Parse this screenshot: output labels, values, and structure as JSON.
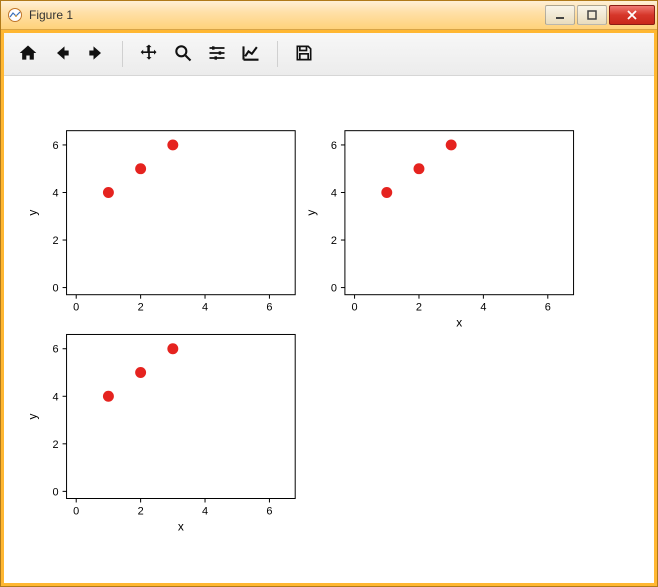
{
  "window": {
    "title": "Figure 1"
  },
  "toolbar": {
    "home": "home-icon",
    "back": "back-icon",
    "forward": "forward-icon",
    "pan": "pan-icon",
    "zoom": "zoom-icon",
    "configure": "configure-icon",
    "axes": "axes-icon",
    "save": "save-icon"
  },
  "chart_data": [
    {
      "type": "scatter",
      "x": [
        1,
        2,
        3
      ],
      "y": [
        4,
        5,
        6
      ],
      "xlabel": "",
      "ylabel": "y",
      "xticks": [
        0,
        2,
        4,
        6
      ],
      "yticks": [
        0,
        2,
        4,
        6
      ],
      "xlim": [
        -0.3,
        6.8
      ],
      "ylim": [
        -0.3,
        6.6
      ],
      "marker_color": "#e5231f"
    },
    {
      "type": "scatter",
      "x": [
        1,
        2,
        3
      ],
      "y": [
        4,
        5,
        6
      ],
      "xlabel": "x",
      "ylabel": "y",
      "xticks": [
        0,
        2,
        4,
        6
      ],
      "yticks": [
        0,
        2,
        4,
        6
      ],
      "xlim": [
        -0.3,
        6.8
      ],
      "ylim": [
        -0.3,
        6.6
      ],
      "marker_color": "#e5231f"
    },
    {
      "type": "scatter",
      "x": [
        1,
        2,
        3
      ],
      "y": [
        4,
        5,
        6
      ],
      "xlabel": "x",
      "ylabel": "y",
      "xticks": [
        0,
        2,
        4,
        6
      ],
      "yticks": [
        0,
        2,
        4,
        6
      ],
      "xlim": [
        -0.3,
        6.8
      ],
      "ylim": [
        -0.3,
        6.6
      ],
      "marker_color": "#e5231f"
    }
  ],
  "layout": {
    "subplots": [
      {
        "row": 0,
        "col": 0,
        "chart_index": 0
      },
      {
        "row": 0,
        "col": 1,
        "chart_index": 1
      },
      {
        "row": 1,
        "col": 0,
        "chart_index": 2
      }
    ]
  }
}
